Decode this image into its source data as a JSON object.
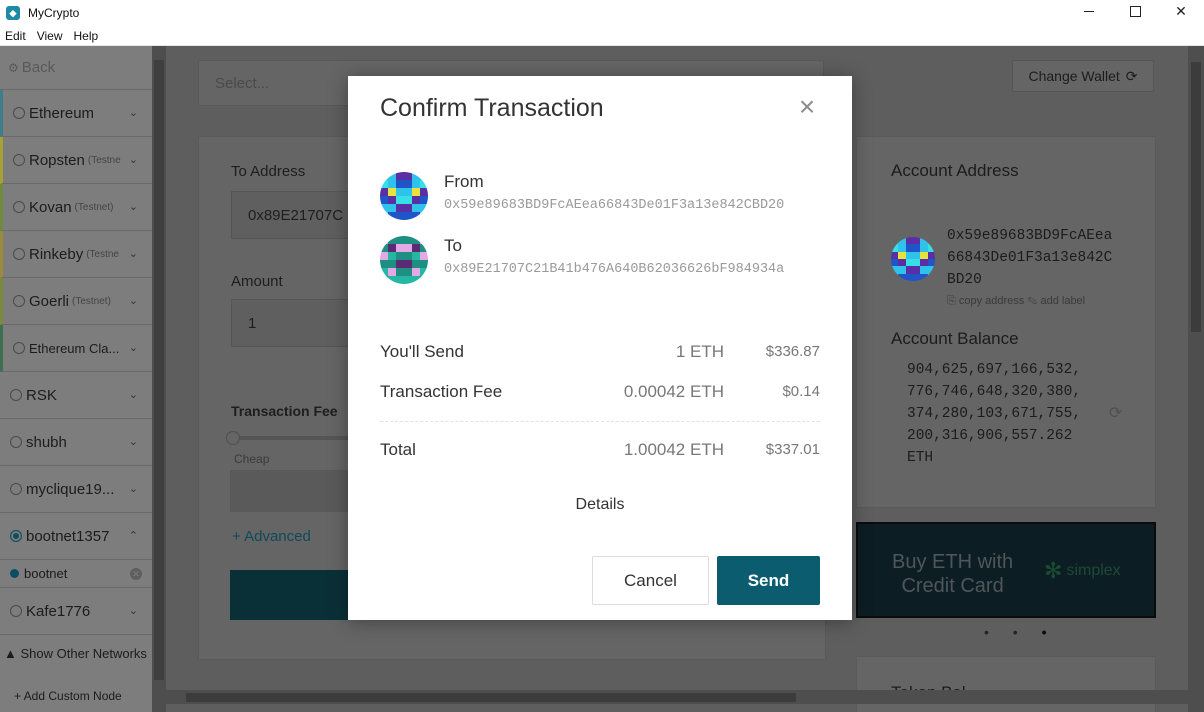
{
  "window": {
    "title": "MyCrypto",
    "minimize_label": "",
    "maximize_label": "",
    "close_label": "✕"
  },
  "menu": [
    "Edit",
    "View",
    "Help"
  ],
  "sidebar": {
    "back_label": "Back",
    "networks": [
      {
        "name": "Ethereum",
        "tag": "",
        "stripe": "#3e7d8a"
      },
      {
        "name": "Ropsten",
        "tag": "(Testne",
        "stripe": "#a7a037"
      },
      {
        "name": "Kovan",
        "tag": "(Testnet)",
        "stripe": "#708a3c"
      },
      {
        "name": "Rinkeby",
        "tag": "(Testne",
        "stripe": "#9a8a3a"
      },
      {
        "name": "Goerli",
        "tag": "(Testnet)",
        "stripe": "#7a8a3a"
      },
      {
        "name": "Ethereum Cla...",
        "tag": "",
        "stripe": "#3f6f52"
      },
      {
        "name": "RSK",
        "tag": "",
        "stripe": ""
      },
      {
        "name": "shubh",
        "tag": "",
        "stripe": ""
      },
      {
        "name": "myclique19...",
        "tag": "",
        "stripe": ""
      },
      {
        "name": "bootnet1357",
        "tag": "",
        "stripe": ""
      },
      {
        "name": "Kafe1776",
        "tag": "",
        "stripe": ""
      }
    ],
    "sub_node": "bootnet",
    "show_other_networks": "Show Other Networks",
    "add_custom_node": "+ Add Custom Node"
  },
  "main": {
    "select_placeholder": "Select...",
    "change_wallet": "Change Wallet",
    "to_address_label": "To Address",
    "to_address_value": "0x89E21707C",
    "amount_label": "Amount",
    "amount_value": "1",
    "fee_label": "Transaction Fee",
    "cheap_label": "Cheap",
    "advanced_label": "+ Advanced"
  },
  "account": {
    "address_title": "Account Address",
    "address": "0x59e89683BD9FcAEea66843De01F3a13e842CBD20",
    "copy_address": "copy address",
    "add_label": "add label",
    "balance_title": "Account Balance",
    "balance": "904,625,697,166,532,776,746,648,320,380,374,280,103,671,755,200,316,906,557.262 ETH"
  },
  "banner": {
    "line1": "Buy ETH with",
    "line2": "Credit Card",
    "partner": "simplex"
  },
  "token_balances_title": "Token Bal",
  "modal": {
    "title": "Confirm Transaction",
    "from_label": "From",
    "from_address": "0x59e89683BD9FcAEea66843De01F3a13e842CBD20",
    "to_label": "To",
    "to_address": "0x89E21707C21B41b476A640B62036626bF984934a",
    "send_label": "You'll Send",
    "send_amount": "1 ETH",
    "send_usd": "$336.87",
    "fee_label": "Transaction Fee",
    "fee_amount": "0.00042 ETH",
    "fee_usd": "$0.14",
    "total_label": "Total",
    "total_amount": "1.00042 ETH",
    "total_usd": "$337.01",
    "details_label": "Details",
    "cancel_label": "Cancel",
    "confirm_label": "Send"
  },
  "colors": {
    "primary": "#0b5c6f",
    "overlay": "#5e5e5e"
  }
}
